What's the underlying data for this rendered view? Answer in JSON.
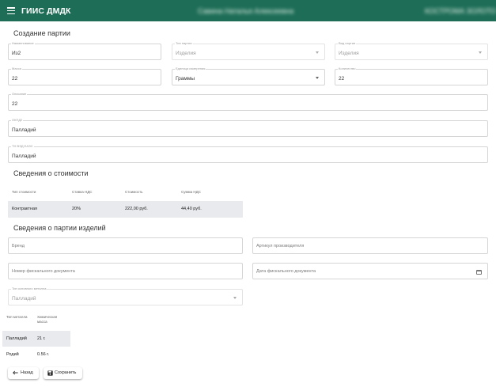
{
  "header": {
    "app_title": "ГИИС ДМДК",
    "user_name": "Савина Наталья Алексеевна",
    "org_name": "КОСТРОМА ЗОЛОТО"
  },
  "creation": {
    "title": "Создание партии",
    "name_label": "Наименование",
    "name_value": "Из2",
    "type_label": "Тип партии",
    "type_value": "Изделия",
    "kind_label": "Вид партии",
    "kind_value": "Изделия",
    "weight_label": "Масса",
    "weight_value": "22",
    "unit_label": "Единица измерения",
    "unit_value": "Граммы",
    "qty_label": "Количество",
    "qty_value": "22",
    "desc_label": "Описание",
    "desc_value": "22",
    "okpd_label": "ОКПД2",
    "okpd_value": "Палладий",
    "tnved_label": "ТН ВЭД ЕАЭС",
    "tnved_value": "Палладий"
  },
  "cost": {
    "title": "Сведения о стоимости",
    "headers": [
      "Тип стоимости",
      "Ставка НДС",
      "Стоимость",
      "Сумма НДС"
    ],
    "rows": [
      [
        "Контрактная",
        "20%",
        "222,00 руб.",
        "44,40 руб."
      ]
    ]
  },
  "items": {
    "title": "Сведения о партии изделий",
    "brand_placeholder": "Бренд",
    "article_placeholder": "Артикул производителя",
    "fiscal_number_placeholder": "Номер фискального документа",
    "fiscal_date_placeholder": "Дата фискального документа",
    "metal_type_label": "Тип основного металла",
    "metal_type_value": "Палладий",
    "metals_headers": [
      "Тип металла",
      "Химическая масса"
    ],
    "metals_rows": [
      [
        "Палладий",
        "21 г."
      ],
      [
        "Родий",
        "0.56 г."
      ]
    ]
  },
  "footer": {
    "back_label": "Назад",
    "save_label": "Сохранить"
  },
  "colors": {
    "header_bg": "#1e6e57",
    "row_highlight": "#e8eaed"
  },
  "icons": [
    "menu-icon",
    "chevron-down-icon",
    "calendar-icon",
    "arrow-left-icon",
    "save-icon"
  ]
}
